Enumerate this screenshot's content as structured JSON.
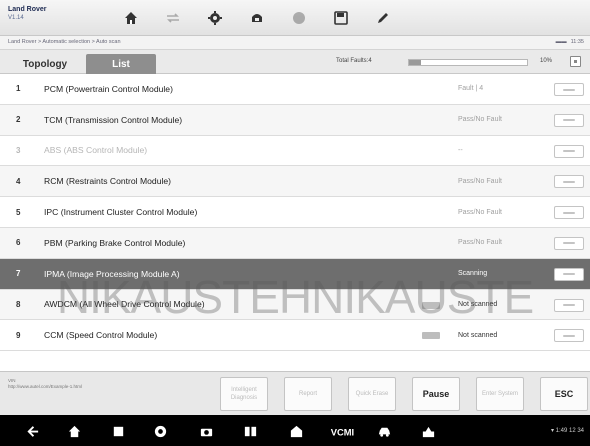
{
  "header": {
    "brand": "Land Rover",
    "version": "V1.14",
    "toolbar": [
      {
        "name": "home-icon",
        "active": true
      },
      {
        "name": "vehicle-swap-icon",
        "active": false
      },
      {
        "name": "settings-icon",
        "active": true
      },
      {
        "name": "vci-icon",
        "active": true
      },
      {
        "name": "record-icon",
        "active": false
      },
      {
        "name": "save-icon",
        "active": true
      },
      {
        "name": "edit-icon",
        "active": true
      }
    ]
  },
  "breadcrumb": "Land Rover > Automatic selection > Auto scan",
  "status": {
    "battery": "▬▬",
    "time": "11:35"
  },
  "tabs": {
    "topology": "Topology",
    "list": "List"
  },
  "scan": {
    "faults_label": "Total Faults:4",
    "progress": 0.1,
    "percent": "10%"
  },
  "modules": [
    {
      "no": "1",
      "name": "PCM (Powertrain Control Module)",
      "result": "Fault | 4",
      "state": "normal"
    },
    {
      "no": "2",
      "name": "TCM (Transmission Control Module)",
      "result": "Pass/No Fault",
      "state": "normal"
    },
    {
      "no": "3",
      "name": "ABS (ABS Control Module)",
      "result": "--",
      "state": "dim"
    },
    {
      "no": "4",
      "name": "RCM (Restraints Control Module)",
      "result": "Pass/No Fault",
      "state": "normal"
    },
    {
      "no": "5",
      "name": "IPC (Instrument Cluster Control Module)",
      "result": "Pass/No Fault",
      "state": "normal"
    },
    {
      "no": "6",
      "name": "PBM (Parking Brake Control Module)",
      "result": "Pass/No Fault",
      "state": "normal"
    },
    {
      "no": "7",
      "name": "IPMA (Image Processing Module A)",
      "result": "Scanning",
      "state": "current"
    },
    {
      "no": "8",
      "name": "AWDCM (All Wheel Drive Control Module)",
      "result": "Not scanned",
      "state": "normal"
    },
    {
      "no": "9",
      "name": "CCM (Speed Control Module)",
      "result": "Not scanned",
      "state": "normal"
    }
  ],
  "watermark": "NIKAUSTEHNIKAUSTE",
  "footer_info": [
    "VIN",
    "http://www.autel.com/Example-1.html"
  ],
  "actions": [
    {
      "label": "Intelligent Diagnosis",
      "enabled": false
    },
    {
      "label": "Report",
      "enabled": false
    },
    {
      "label": "Quick Erase",
      "enabled": false
    },
    {
      "label": "Pause",
      "enabled": true
    },
    {
      "label": "Enter System",
      "enabled": false
    },
    {
      "label": "ESC",
      "enabled": true
    }
  ],
  "navbar": {
    "icons": [
      "back-icon",
      "home-icon",
      "recent-apps-icon",
      "browser-icon",
      "camera-icon",
      "display-icon",
      "garage-icon",
      "vcmi-icon",
      "car-icon",
      "vehicle-mode-icon"
    ],
    "status": "▾ 1:49 12 34"
  },
  "colors": {
    "selected_tab": "#8e8e8e",
    "current_row": "#6e6e6e",
    "navbar": "#000000"
  }
}
